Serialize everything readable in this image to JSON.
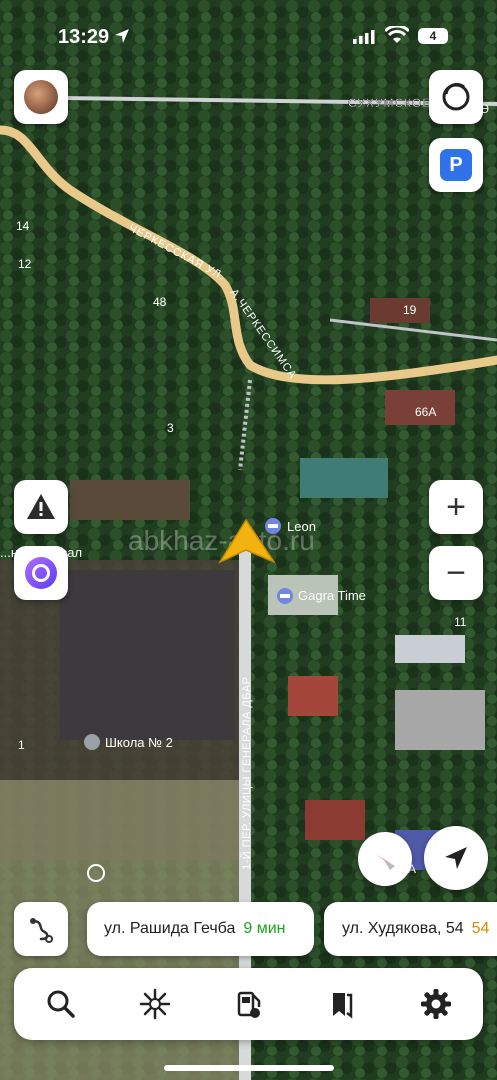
{
  "status_bar": {
    "time": "13:29",
    "battery": "4"
  },
  "map": {
    "streets": [
      {
        "label": "СУХУМСКОЕ Ш",
        "extra": "КӘ"
      },
      {
        "label": "ЧЕРКЕССКАЯ УЛ."
      },
      {
        "label": "А.ЧЕРКЕССИМСА"
      },
      {
        "label": "1-Й ПЕР. УЛИЦЫ ГЕНЕРАЛА ДБАР"
      }
    ],
    "house_numbers": [
      "14",
      "12",
      "48",
      "19",
      "3",
      "66А",
      "11",
      "1",
      "А"
    ],
    "pois": [
      {
        "name": "Leon",
        "icon": "hotel-icon"
      },
      {
        "name": "Gagra Time",
        "icon": "hotel-icon"
      },
      {
        "name": "Школа № 2",
        "icon": "school-icon"
      },
      {
        "name": "...нажный зал",
        "icon": "none"
      }
    ],
    "watermark": "abkhaz-auto.ru",
    "colors": {
      "road": "#e9c98a",
      "foliage": "#1f3a1e",
      "navigation_arrow": "#f2b310",
      "parking": "#2f72ea",
      "eta_near": "#1ba51b",
      "eta_far": "#e08a00",
      "alice": "#7b4bf0"
    }
  },
  "controls": {
    "parking_label": "P",
    "zoom_in": "+",
    "zoom_out": "−"
  },
  "route_suggestions": [
    {
      "street": "ул. Рашида Гечба",
      "eta": "9 мин"
    },
    {
      "street": "ул. Худякова, 54",
      "eta": "54"
    }
  ],
  "bottom_nav": [
    {
      "name": "search-icon"
    },
    {
      "name": "discovery-icon"
    },
    {
      "name": "fuel-icon"
    },
    {
      "name": "bookmarks-icon"
    },
    {
      "name": "settings-icon"
    }
  ]
}
